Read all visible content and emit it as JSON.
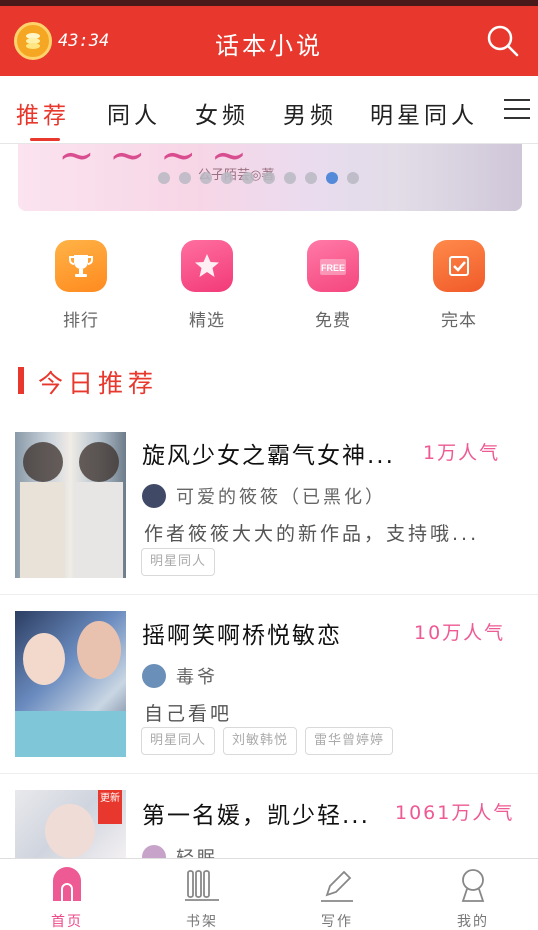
{
  "header": {
    "timer": "43:34",
    "title": "话本小说"
  },
  "tabs": [
    {
      "label": "推荐",
      "active": true
    },
    {
      "label": "同人",
      "active": false
    },
    {
      "label": "女频",
      "active": false
    },
    {
      "label": "男频",
      "active": false
    },
    {
      "label": "明星同人",
      "active": false
    }
  ],
  "banner": {
    "author_text": "公子陌芸◎著",
    "dot_count": 10,
    "active_dot": 8
  },
  "quick_menu": [
    {
      "label": "排行",
      "icon": "trophy-icon"
    },
    {
      "label": "精选",
      "icon": "star-icon"
    },
    {
      "label": "免费",
      "icon": "free-icon"
    },
    {
      "label": "完本",
      "icon": "check-icon"
    }
  ],
  "section": {
    "title": "今日推荐"
  },
  "books": [
    {
      "title": "旋风少女之霸气女神...",
      "popularity": "1万人气",
      "author": "可爱的筱筱（已黑化）",
      "desc": "作者筱筱大大的新作品，支持哦...",
      "tags": [
        "明星同人"
      ]
    },
    {
      "title": "摇啊笑啊桥悦敏恋",
      "popularity": "10万人气",
      "author": "毒爷",
      "desc": "自己看吧",
      "tags": [
        "明星同人",
        "刘敏韩悦",
        "雷华曾婷婷"
      ]
    },
    {
      "title": "第一名媛，凯少轻...",
      "popularity": "1061万人气",
      "author": "轻眠",
      "badge": "更新"
    }
  ],
  "bottom_nav": [
    {
      "label": "首页",
      "icon": "home-icon",
      "active": true
    },
    {
      "label": "书架",
      "icon": "bookshelf-icon",
      "active": false
    },
    {
      "label": "写作",
      "icon": "pen-icon",
      "active": false
    },
    {
      "label": "我的",
      "icon": "profile-icon",
      "active": false
    }
  ],
  "colors": {
    "brand_red": "#e8382e",
    "popularity_pink": "#ee5a93"
  }
}
